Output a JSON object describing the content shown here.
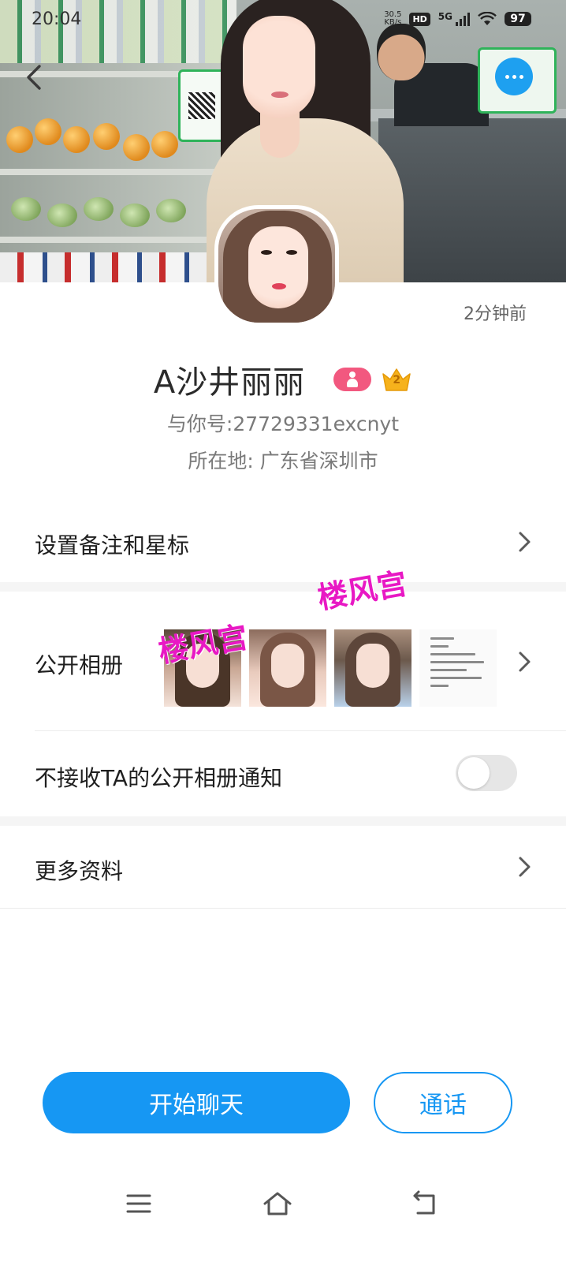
{
  "status_bar": {
    "time": "20:04",
    "net_speed_value": "30.5",
    "net_speed_unit": "KB/s",
    "hd_label": "HD",
    "network_label": "5G",
    "battery": "97"
  },
  "header": {
    "back_icon": "chevron-left-icon",
    "more_icon": "more-horizontal-icon"
  },
  "profile": {
    "last_seen": "2分钟前",
    "name": "A沙井丽丽",
    "gender_badge_icon": "person-icon",
    "level_badge_icon": "crown-icon",
    "level": "2",
    "account_id": "与你号:27729331excnyt",
    "location": "所在地: 广东省深圳市"
  },
  "rows": {
    "remark_label": "设置备注和星标",
    "album_label": "公开相册",
    "album_watermark": "楼风宫",
    "notify_label": "不接收TA的公开相册通知",
    "notify_toggle_on": false,
    "more_info_label": "更多资料"
  },
  "actions": {
    "chat_label": "开始聊天",
    "call_label": "通话"
  },
  "colors": {
    "accent": "#1697f3",
    "gender_badge": "#f2587f",
    "crown": "#f6b21c",
    "watermark": "#e818c4"
  },
  "nav": {
    "menu_icon": "menu-icon",
    "home_icon": "home-icon",
    "back_icon": "back-icon"
  }
}
